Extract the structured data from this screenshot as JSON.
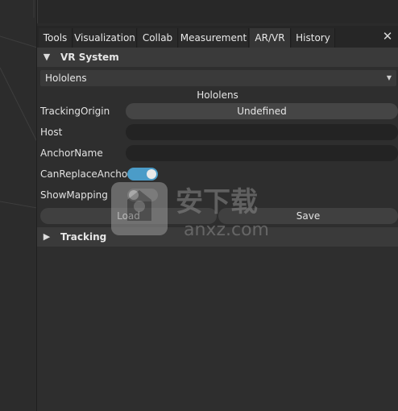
{
  "tabs": [
    {
      "label": "Tools",
      "active": false
    },
    {
      "label": "Visualization",
      "active": false
    },
    {
      "label": "Collab",
      "active": false
    },
    {
      "label": "Measurement",
      "active": false
    },
    {
      "label": "AR/VR",
      "active": true
    },
    {
      "label": "History",
      "active": false
    }
  ],
  "tab_close_icon": "close-icon",
  "vr_section": {
    "title": "VR System",
    "expanded": true,
    "device_dropdown": {
      "selected": "Hololens"
    },
    "selected_device_label": "Hololens",
    "fields": {
      "tracking_origin": {
        "label": "TrackingOrigin",
        "value": "Undefined"
      },
      "host": {
        "label": "Host",
        "value": ""
      },
      "anchor_name": {
        "label": "AnchorName",
        "value": ""
      },
      "can_replace_anchor": {
        "label": "CanReplaceAnchor",
        "checked": true
      },
      "show_mapping": {
        "label": "ShowMapping",
        "checked": false
      }
    },
    "load_label": "Load",
    "save_label": "Save"
  },
  "tracking_section": {
    "title": "Tracking",
    "expanded": false
  },
  "watermark": {
    "text": "安下载",
    "subtext": "anxz.com"
  },
  "colors": {
    "accent": "#4b9cc8",
    "panel_bg": "#2e2e2e",
    "header_bg": "#3a3a3a"
  }
}
